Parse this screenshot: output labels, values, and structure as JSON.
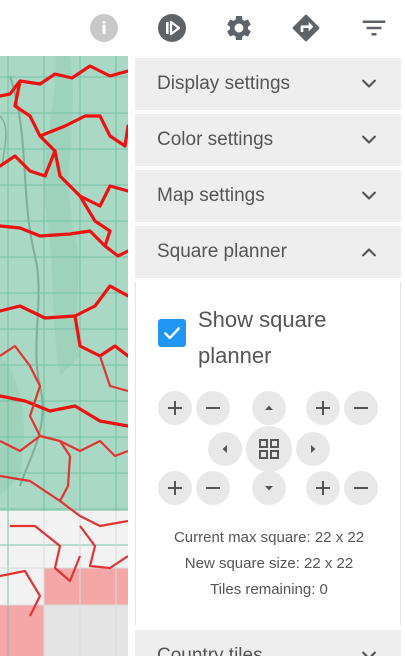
{
  "toolbar": {
    "info_label": "i"
  },
  "panel": {
    "sections": [
      {
        "title": "Display settings",
        "expanded": false
      },
      {
        "title": "Color settings",
        "expanded": false
      },
      {
        "title": "Map settings",
        "expanded": false
      },
      {
        "title": "Square planner",
        "expanded": true
      },
      {
        "title": "Country tiles",
        "expanded": false
      }
    ],
    "square_planner": {
      "show_label": "Show square planner",
      "show_checked": true,
      "current_max": "Current max square: 22 x 22",
      "new_size": "New square size: 22 x 22",
      "tiles_remaining": "Tiles remaining: 0"
    }
  },
  "colors": {
    "accent": "#2196f3",
    "map_green": "#a9d9c4",
    "route_red": "#ee1111",
    "header_bg": "#eeeeee",
    "icon_dark": "#5f6368",
    "icon_disabled": "#bdbdbd"
  }
}
